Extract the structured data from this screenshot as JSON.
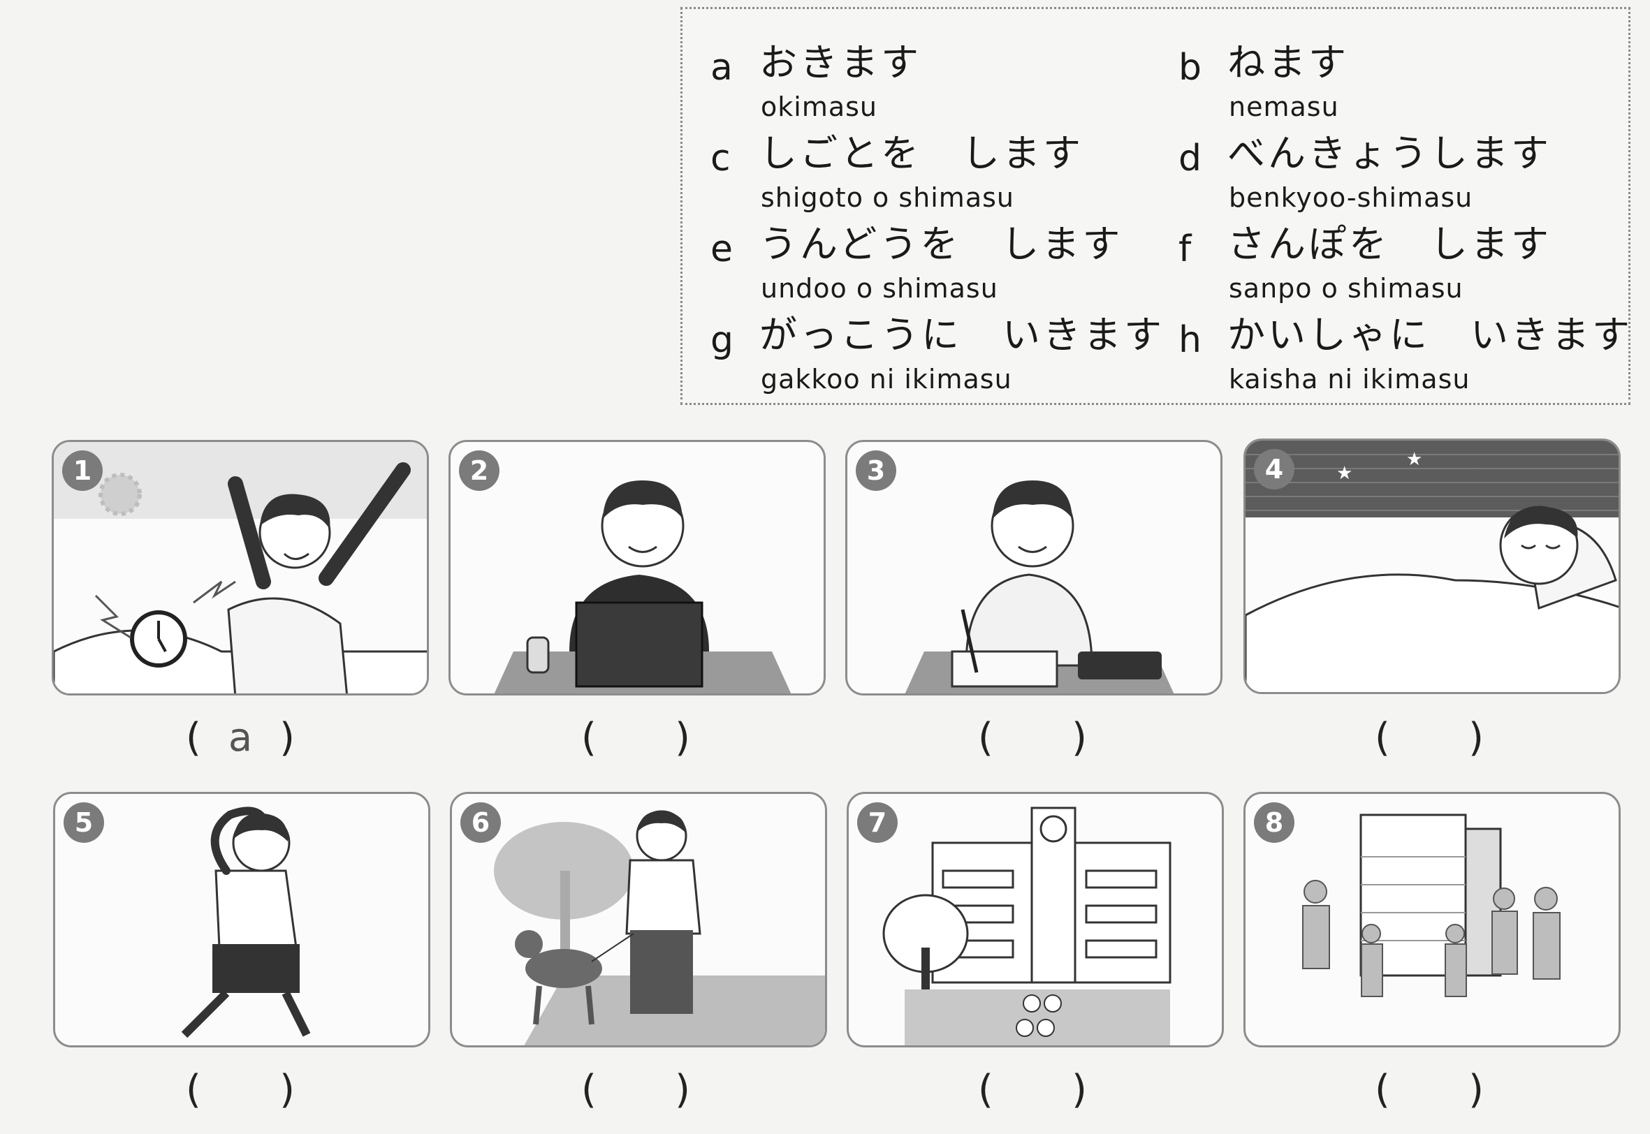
{
  "vocabulary": [
    {
      "letter": "a",
      "kana": "おきます",
      "romaji": "okimasu"
    },
    {
      "letter": "b",
      "kana": "ねます",
      "romaji": "nemasu"
    },
    {
      "letter": "c",
      "kana": "しごとを　します",
      "romaji": "shigoto o shimasu"
    },
    {
      "letter": "d",
      "kana": "べんきょうします",
      "romaji": "benkyoo-shimasu"
    },
    {
      "letter": "e",
      "kana": "うんどうを　します",
      "romaji": "undoo o shimasu"
    },
    {
      "letter": "f",
      "kana": "さんぽを　します",
      "romaji": "sanpo o shimasu"
    },
    {
      "letter": "g",
      "kana": "がっこうに　いきます",
      "romaji": "gakkoo ni ikimasu"
    },
    {
      "letter": "h",
      "kana": "かいしゃに　いきます",
      "romaji": "kaisha ni ikimasu"
    }
  ],
  "exercises": [
    {
      "number": "1",
      "answer": "a"
    },
    {
      "number": "2",
      "answer": ""
    },
    {
      "number": "3",
      "answer": ""
    },
    {
      "number": "4",
      "answer": ""
    },
    {
      "number": "5",
      "answer": ""
    },
    {
      "number": "6",
      "answer": ""
    },
    {
      "number": "7",
      "answer": ""
    },
    {
      "number": "8",
      "answer": ""
    }
  ],
  "answer_brackets": {
    "open": "(",
    "close": ")"
  }
}
